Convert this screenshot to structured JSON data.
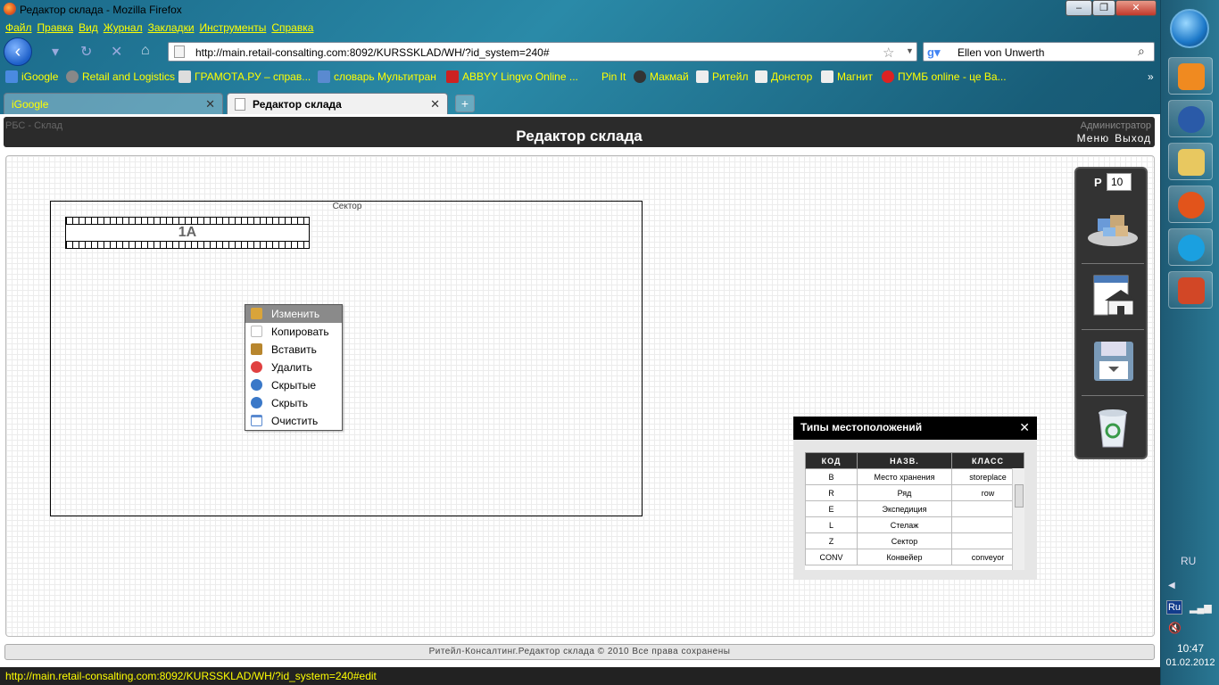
{
  "window": {
    "title": "Редактор склада - Mozilla Firefox"
  },
  "menu": [
    "Файл",
    "Правка",
    "Вид",
    "Журнал",
    "Закладки",
    "Инструменты",
    "Справка"
  ],
  "url": "http://main.retail-consalting.com:8092/KURSSKLAD/WH/?id_system=240#",
  "search": {
    "value": "Ellen von Unwerth"
  },
  "bookmarks": [
    "iGoogle",
    "Retail and Logistics",
    "ГРАМОТА.РУ – справ...",
    "словарь Мультитран",
    "ABBYY Lingvo Online ...",
    "Pin It",
    "Макмай",
    "Ритейл",
    "Донстор",
    "Магнит",
    "ПУМБ online - це Ва..."
  ],
  "tabs": [
    {
      "label": "iGoogle",
      "active": false
    },
    {
      "label": "Редактор склада",
      "active": true
    }
  ],
  "app": {
    "brand": "РБС - Склад",
    "title": "Редактор склада",
    "user": "Администратор",
    "menu_link": "Меню",
    "exit_link": "Выход"
  },
  "editor": {
    "sector_label": "Сектор",
    "row_label": "1A",
    "toolbar_p_label": "P",
    "toolbar_p_value": "10"
  },
  "context_menu": [
    {
      "label": "Изменить",
      "icon": "edit-icon",
      "color": "#d9a43a"
    },
    {
      "label": "Копировать",
      "icon": "copy-icon",
      "color": "#c8c8c8"
    },
    {
      "label": "Вставить",
      "icon": "paste-icon",
      "color": "#b8862e"
    },
    {
      "label": "Удалить",
      "icon": "delete-icon",
      "color": "#e04040"
    },
    {
      "label": "Скрытые",
      "icon": "info-icon",
      "color": "#3a78c8"
    },
    {
      "label": "Скрыть",
      "icon": "info-icon",
      "color": "#3a78c8"
    },
    {
      "label": "Очистить",
      "icon": "clear-icon",
      "color": "#5a8ad0"
    }
  ],
  "types_panel": {
    "title": "Типы местоположений",
    "columns": [
      "КОД",
      "НАЗВ.",
      "КЛАСС"
    ],
    "rows": [
      [
        "B",
        "Место хранения",
        "storeplace"
      ],
      [
        "R",
        "Ряд",
        "row"
      ],
      [
        "E",
        "Экспедиция",
        ""
      ],
      [
        "L",
        "Стелаж",
        ""
      ],
      [
        "Z",
        "Сектор",
        ""
      ],
      [
        "CONV",
        "Конвейер",
        "conveyor"
      ]
    ]
  },
  "footer": "Ритейл-Консалтинг.Редактор склада © 2010 Все права сохранены",
  "status": "http://main.retail-consalting.com:8092/KURSSKLAD/WH/?id_system=240#edit",
  "taskbar": {
    "lang": "RU",
    "kb": "Ru",
    "time": "10:47",
    "date": "01.02.2012"
  }
}
